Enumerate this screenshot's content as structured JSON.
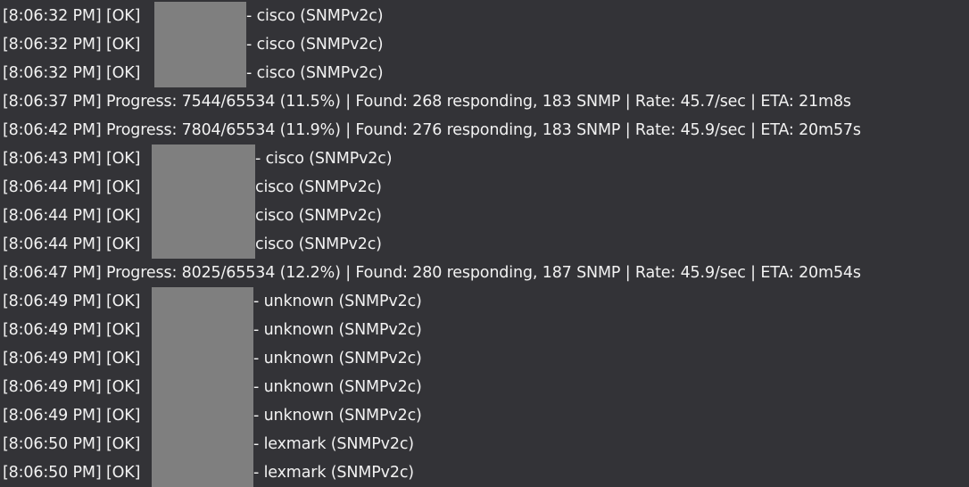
{
  "console": {
    "lines": [
      {
        "time": "[8:06:32 PM]",
        "tag": "[OK]",
        "text": "- cisco (SNMPv2c)"
      },
      {
        "time": "[8:06:32 PM]",
        "tag": "[OK]",
        "text": "- cisco (SNMPv2c)"
      },
      {
        "time": "[8:06:32 PM]",
        "tag": "[OK]",
        "text": "- cisco (SNMPv2c)"
      },
      {
        "time": "[8:06:37 PM]",
        "text": "Progress: 7544/65534 (11.5%) | Found: 268 responding, 183 SNMP | Rate: 45.7/sec | ETA: 21m8s"
      },
      {
        "time": "[8:06:42 PM]",
        "text": "Progress: 7804/65534 (11.9%) | Found: 276 responding, 183 SNMP | Rate: 45.9/sec | ETA: 20m57s"
      },
      {
        "time": "[8:06:43 PM]",
        "tag": "[OK]",
        "text": "- cisco (SNMPv2c)"
      },
      {
        "time": "[8:06:44 PM]",
        "tag": "[OK]",
        "text": "cisco (SNMPv2c)"
      },
      {
        "time": "[8:06:44 PM]",
        "tag": "[OK]",
        "text": "cisco (SNMPv2c)"
      },
      {
        "time": "[8:06:44 PM]",
        "tag": "[OK]",
        "text": "cisco (SNMPv2c)"
      },
      {
        "time": "[8:06:47 PM]",
        "text": "Progress: 8025/65534 (12.2%) | Found: 280 responding, 187 SNMP | Rate: 45.9/sec | ETA: 20m54s"
      },
      {
        "time": "[8:06:49 PM]",
        "tag": "[OK]",
        "text": "- unknown (SNMPv2c)"
      },
      {
        "time": "[8:06:49 PM]",
        "tag": "[OK]",
        "text": "- unknown (SNMPv2c)"
      },
      {
        "time": "[8:06:49 PM]",
        "tag": "[OK]",
        "text": "- unknown (SNMPv2c)"
      },
      {
        "time": "[8:06:49 PM]",
        "tag": "[OK]",
        "text": "- unknown (SNMPv2c)"
      },
      {
        "time": "[8:06:49 PM]",
        "tag": "[OK]",
        "text": "- unknown (SNMPv2c)"
      },
      {
        "time": "[8:06:50 PM]",
        "tag": "[OK]",
        "text": "- lexmark (SNMPv2c)"
      },
      {
        "time": "[8:06:50 PM]",
        "tag": "[OK]",
        "text": "- lexmark (SNMPv2c)"
      }
    ]
  },
  "colors": {
    "background": "#333337",
    "text": "#f2f2f2",
    "redaction": "#7f7f7f"
  }
}
